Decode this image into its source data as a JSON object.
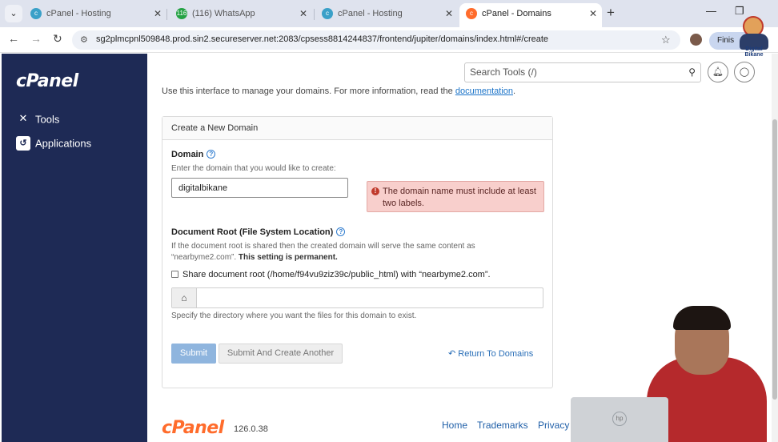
{
  "browser": {
    "tabs": [
      {
        "label": "cPanel - Hosting",
        "icon": "cpanel-tab-icon",
        "active": false
      },
      {
        "label": "(116) WhatsApp",
        "icon": "whatsapp-icon",
        "active": false
      },
      {
        "label": "cPanel - Hosting",
        "icon": "cpanel-tab-icon",
        "active": false
      },
      {
        "label": "cPanel - Domains",
        "icon": "cpanel-orange-icon",
        "active": true
      }
    ],
    "whatsapp_badge": "116",
    "url": "sg2plmcpnl509848.prod.sin2.secureserver.net:2083/cpsess8814244837/frontend/jupiter/domains/index.html#/create",
    "profile_button": "Finis"
  },
  "sidebar": {
    "logo": "cPanel",
    "items": [
      {
        "label": "Tools",
        "icon": "tools-icon"
      },
      {
        "label": "Applications",
        "icon": "applications-icon"
      }
    ]
  },
  "header": {
    "search_placeholder": "Search Tools (/)"
  },
  "intro": {
    "text": "Use this interface to manage your domains. For more information, read the ",
    "link": "documentation",
    "tail": "."
  },
  "form": {
    "title": "Create a New Domain",
    "domain_label": "Domain",
    "domain_hint": "Enter the domain that you would like to create:",
    "domain_value": "digitalbikane",
    "error": "The domain name must include at least two labels.",
    "docroot_label": "Document Root (File System Location)",
    "docroot_hint_1": "If the document root is shared then the created domain will serve the same content as",
    "docroot_hint_2": "“nearbyme2.com”. ",
    "docroot_hint_bold": "This setting is permanent.",
    "share_label": "Share document root (/home/f94vu9ziz39c/public_html) with “nearbyme2.com”.",
    "docroot_value": "",
    "docroot_help": "Specify the directory where you want the files for this domain to exist.",
    "submit": "Submit",
    "submit_another": "Submit And Create Another",
    "return_link": "Return To Domains"
  },
  "footer": {
    "logo": "cPanel",
    "version": "126.0.38",
    "links": [
      "Home",
      "Trademarks",
      "Privacy P"
    ]
  },
  "overlay": {
    "mascot_text": "Digital Bikane"
  },
  "colors": {
    "sidebar_bg": "#1e2a55",
    "accent_orange": "#ff6c2c",
    "error_bg": "#f8cfcc",
    "submit_bg": "#8fb5de",
    "link_blue": "#1a73c8"
  }
}
